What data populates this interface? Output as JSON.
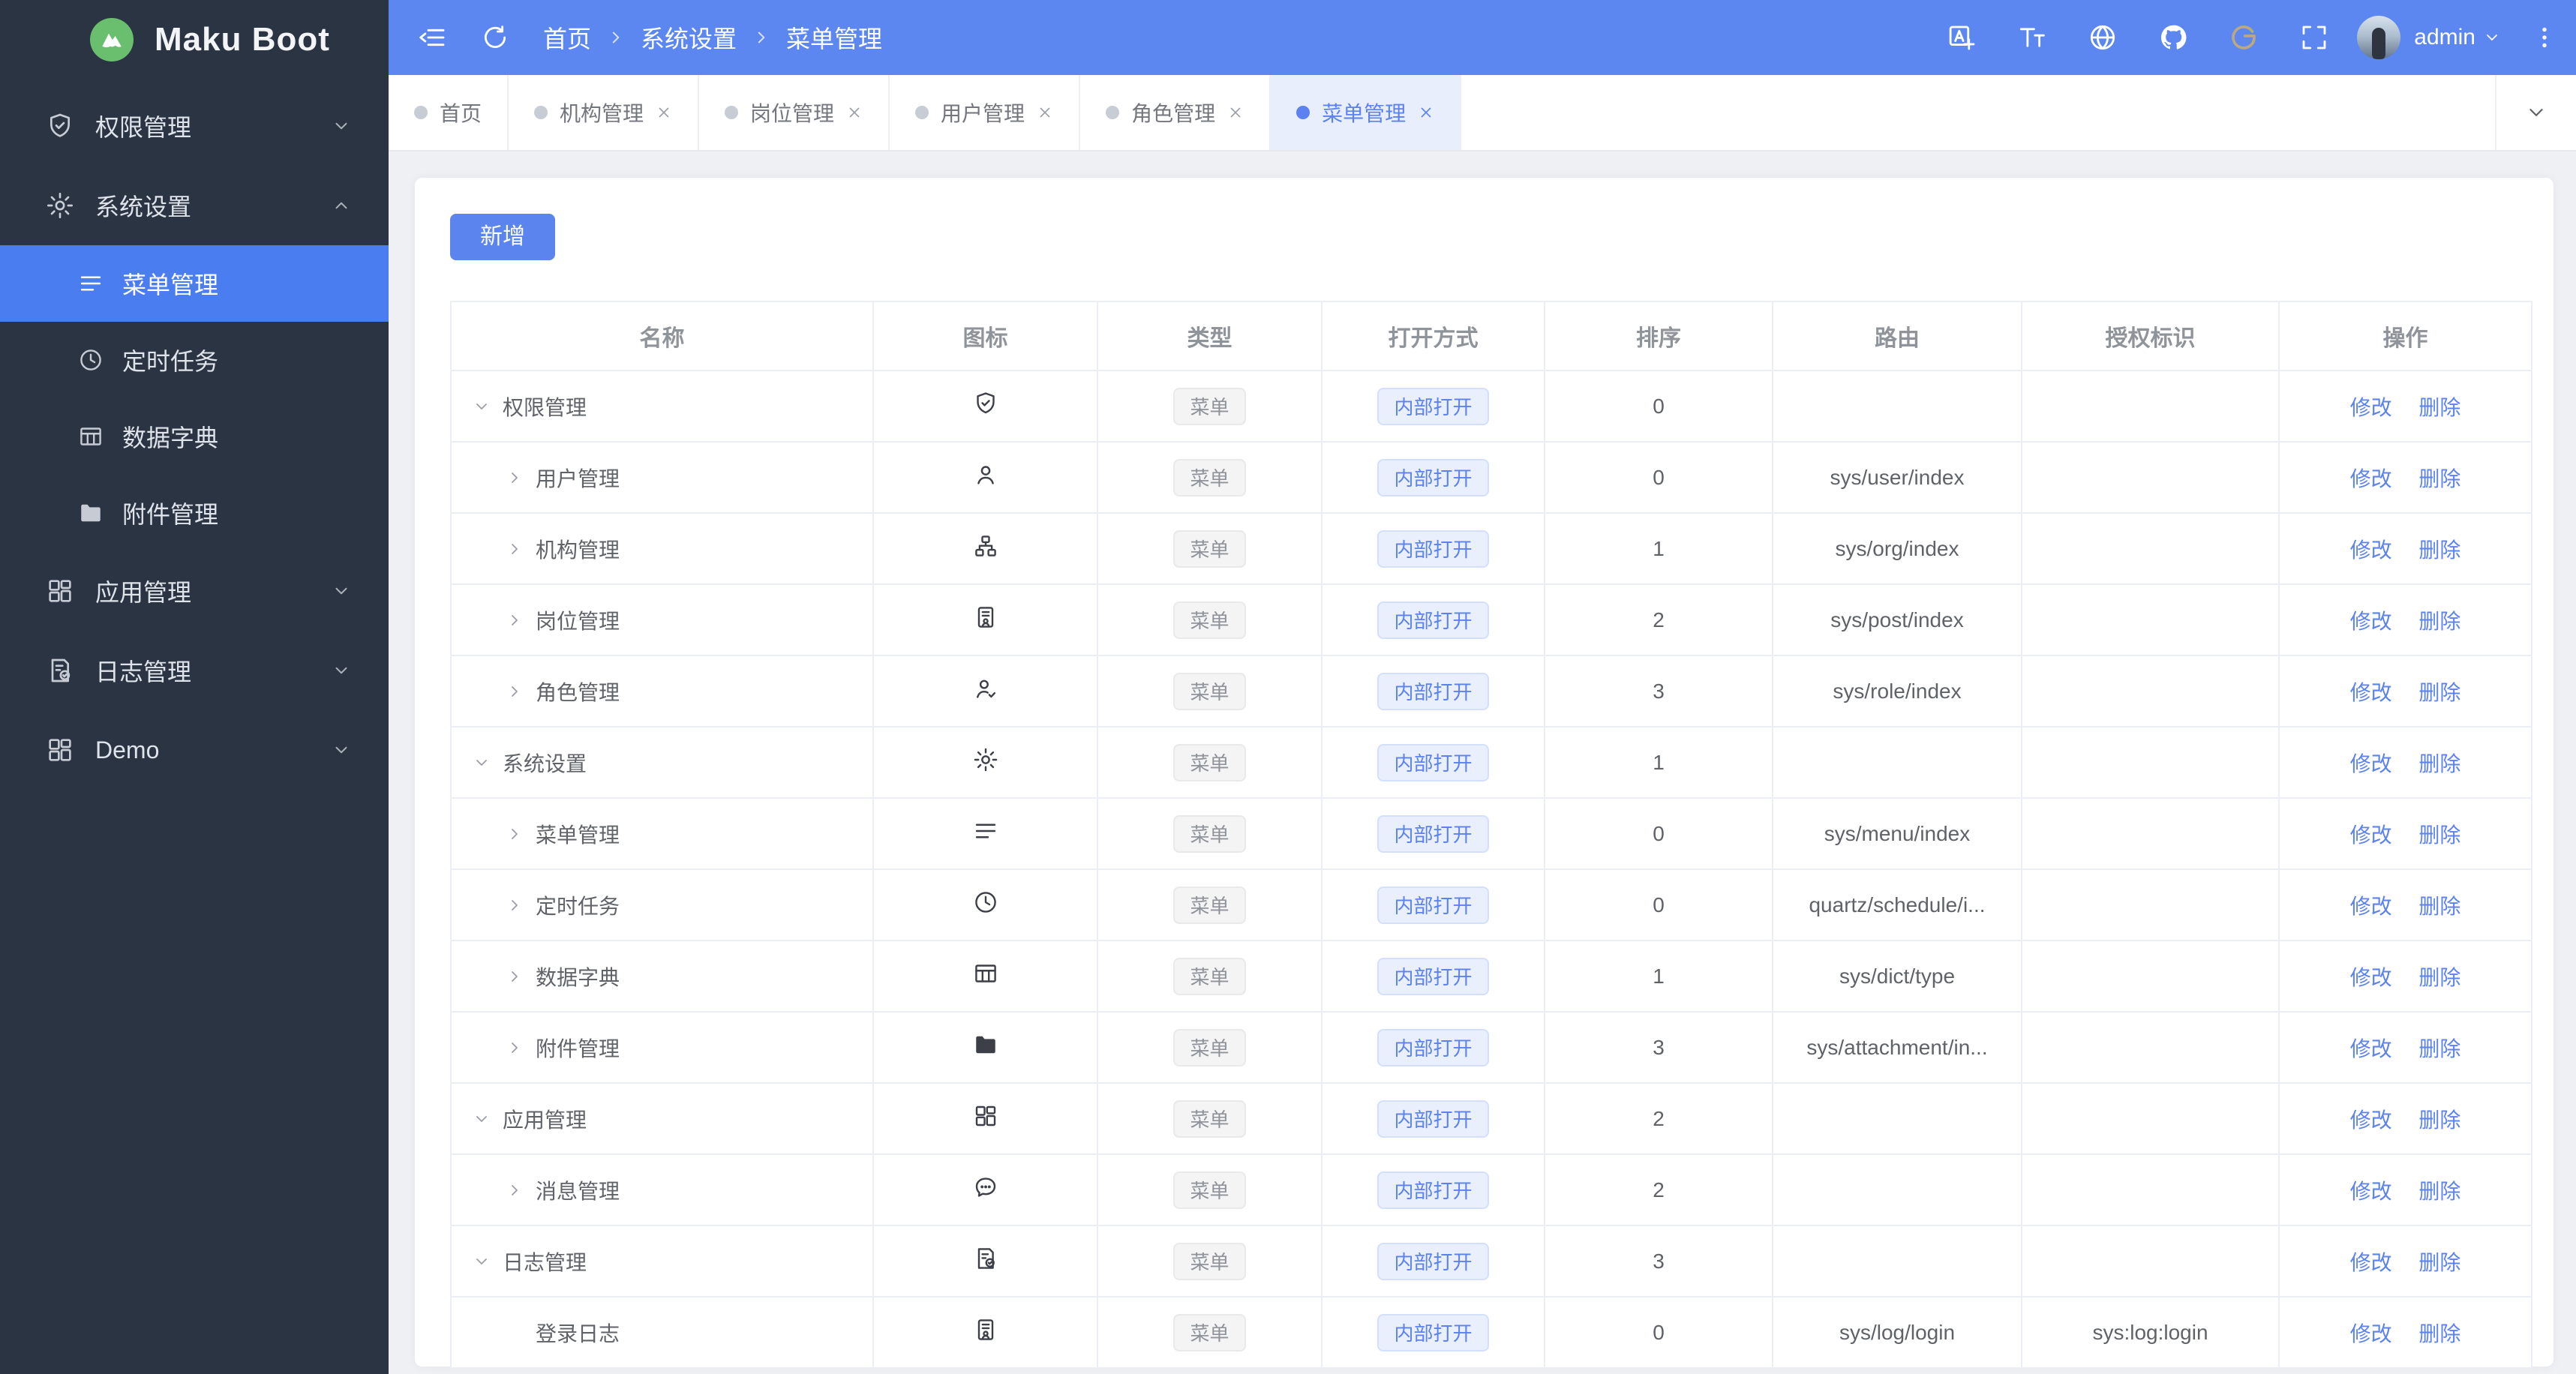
{
  "app": {
    "logo_text": "Maku Boot",
    "logo_icon": "mountain-icon"
  },
  "header": {
    "breadcrumb": [
      "首页",
      "系统设置",
      "菜单管理"
    ],
    "tool_icons": [
      "collapse",
      "refresh"
    ],
    "right_icons": [
      "translate",
      "fontsize",
      "globe",
      "github",
      "gitee",
      "fullscreen"
    ],
    "user": {
      "name": "admin"
    }
  },
  "sidebar": {
    "items": [
      {
        "key": "permission",
        "label": "权限管理",
        "icon": "shield-check",
        "expanded": false
      },
      {
        "key": "system",
        "label": "系统设置",
        "icon": "gear",
        "expanded": true,
        "children": [
          {
            "key": "menu",
            "label": "菜单管理",
            "icon": "menu-lines",
            "active": true
          },
          {
            "key": "schedule",
            "label": "定时任务",
            "icon": "clock",
            "active": false
          },
          {
            "key": "dict",
            "label": "数据字典",
            "icon": "table",
            "active": false
          },
          {
            "key": "attachment",
            "label": "附件管理",
            "icon": "folder",
            "active": false
          }
        ]
      },
      {
        "key": "application",
        "label": "应用管理",
        "icon": "grid",
        "expanded": false
      },
      {
        "key": "log",
        "label": "日志管理",
        "icon": "doc-check",
        "expanded": false
      },
      {
        "key": "demo",
        "label": "Demo",
        "icon": "grid",
        "expanded": false
      }
    ]
  },
  "tabs": [
    {
      "key": "home",
      "label": "首页",
      "closable": false,
      "active": false
    },
    {
      "key": "org",
      "label": "机构管理",
      "closable": true,
      "active": false
    },
    {
      "key": "post",
      "label": "岗位管理",
      "closable": true,
      "active": false
    },
    {
      "key": "user",
      "label": "用户管理",
      "closable": true,
      "active": false
    },
    {
      "key": "role",
      "label": "角色管理",
      "closable": true,
      "active": false
    },
    {
      "key": "menu",
      "label": "菜单管理",
      "closable": true,
      "active": true
    }
  ],
  "toolbar": {
    "add_label": "新增"
  },
  "table": {
    "columns": [
      "名称",
      "图标",
      "类型",
      "打开方式",
      "排序",
      "路由",
      "授权标识",
      "操作"
    ],
    "type_label": "菜单",
    "open_label": "内部打开",
    "action_labels": [
      "修改",
      "删除"
    ],
    "rows": [
      {
        "key": "permission",
        "name": "权限管理",
        "level": 0,
        "expand": "expanded",
        "icon": "shield-check",
        "sort": "0",
        "route": "",
        "auth": ""
      },
      {
        "key": "user",
        "name": "用户管理",
        "level": 1,
        "expand": "collapsed",
        "icon": "user",
        "sort": "0",
        "route": "sys/user/index",
        "auth": ""
      },
      {
        "key": "org",
        "name": "机构管理",
        "level": 1,
        "expand": "collapsed",
        "icon": "org",
        "sort": "1",
        "route": "sys/org/index",
        "auth": ""
      },
      {
        "key": "post",
        "name": "岗位管理",
        "level": 1,
        "expand": "collapsed",
        "icon": "badge",
        "sort": "2",
        "route": "sys/post/index",
        "auth": ""
      },
      {
        "key": "role",
        "name": "角色管理",
        "level": 1,
        "expand": "collapsed",
        "icon": "user-check",
        "sort": "3",
        "route": "sys/role/index",
        "auth": ""
      },
      {
        "key": "system",
        "name": "系统设置",
        "level": 0,
        "expand": "expanded",
        "icon": "gear",
        "sort": "1",
        "route": "",
        "auth": ""
      },
      {
        "key": "menu",
        "name": "菜单管理",
        "level": 1,
        "expand": "collapsed",
        "icon": "menu-lines",
        "sort": "0",
        "route": "sys/menu/index",
        "auth": ""
      },
      {
        "key": "schedule",
        "name": "定时任务",
        "level": 1,
        "expand": "collapsed",
        "icon": "clock",
        "sort": "0",
        "route": "quartz/schedule/i...",
        "auth": ""
      },
      {
        "key": "dict",
        "name": "数据字典",
        "level": 1,
        "expand": "collapsed",
        "icon": "table",
        "sort": "1",
        "route": "sys/dict/type",
        "auth": ""
      },
      {
        "key": "attachment",
        "name": "附件管理",
        "level": 1,
        "expand": "collapsed",
        "icon": "folder",
        "sort": "3",
        "route": "sys/attachment/in...",
        "auth": ""
      },
      {
        "key": "application",
        "name": "应用管理",
        "level": 0,
        "expand": "expanded",
        "icon": "grid",
        "sort": "2",
        "route": "",
        "auth": ""
      },
      {
        "key": "message",
        "name": "消息管理",
        "level": 1,
        "expand": "collapsed",
        "icon": "chat",
        "sort": "2",
        "route": "",
        "auth": ""
      },
      {
        "key": "log",
        "name": "日志管理",
        "level": 0,
        "expand": "expanded",
        "icon": "doc-check",
        "sort": "3",
        "route": "",
        "auth": ""
      },
      {
        "key": "login-log",
        "name": "登录日志",
        "level": 1,
        "expand": "none",
        "icon": "badge",
        "sort": "0",
        "route": "sys/log/login",
        "auth": "sys:log:login"
      }
    ]
  },
  "colors": {
    "primary": "#5b82f0",
    "header_bg": "#5c87f1",
    "sidebar_bg": "#2b3442",
    "sidebar_active_bg": "#4a7df0",
    "content_bg": "#eef0f4",
    "logo_green": "#6abf6e",
    "tag_info_bg": "#f4f4f5",
    "tag_primary_bg": "#e9effd",
    "gitee_gold": "#bda87e"
  }
}
